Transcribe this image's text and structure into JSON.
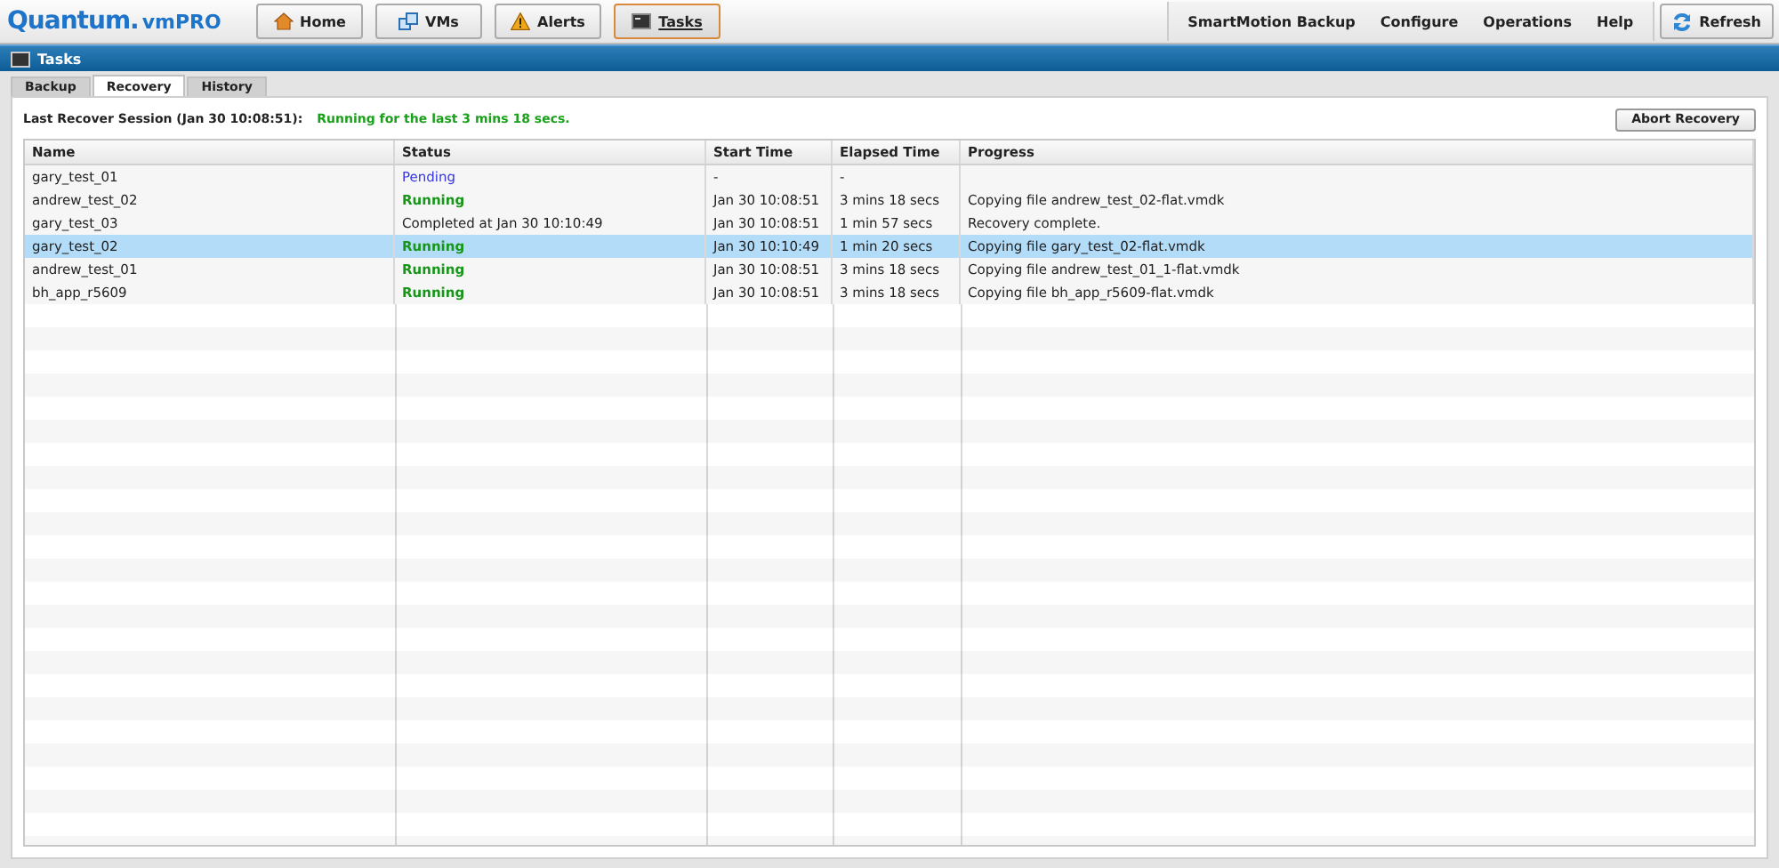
{
  "logo": {
    "brand": "Quantum.",
    "product": "vmPRO"
  },
  "nav": [
    {
      "label": "Home",
      "kind": "home",
      "selected": false
    },
    {
      "label": "VMs",
      "kind": "vms",
      "selected": false
    },
    {
      "label": "Alerts",
      "kind": "alerts",
      "selected": false
    },
    {
      "label": "Tasks",
      "kind": "tasks",
      "selected": true
    }
  ],
  "menu": [
    "SmartMotion Backup",
    "Configure",
    "Operations",
    "Help"
  ],
  "refresh_button": "Refresh",
  "panel_title": "Tasks",
  "tabs": [
    {
      "label": "Backup",
      "selected": false
    },
    {
      "label": "Recovery",
      "selected": true
    },
    {
      "label": "History",
      "selected": false
    }
  ],
  "session": {
    "label": "Last Recover Session (Jan 30 10:08:51):",
    "status": "Running for the last 3 mins 18 secs."
  },
  "abort_button": "Abort Recovery",
  "table": {
    "columns": [
      "Name",
      "Status",
      "Start Time",
      "Elapsed Time",
      "Progress"
    ],
    "rows": [
      {
        "name": "gary_test_01",
        "status": "Pending",
        "kind": "pending",
        "start": "-",
        "elapsed": "-",
        "progress": "",
        "selected": false
      },
      {
        "name": "andrew_test_02",
        "status": "Running",
        "kind": "running",
        "start": "Jan 30 10:08:51",
        "elapsed": "3 mins 18 secs",
        "progress": "Copying file andrew_test_02-flat.vmdk",
        "selected": false
      },
      {
        "name": "gary_test_03",
        "status": "Completed at Jan 30 10:10:49",
        "kind": "completed",
        "start": "Jan 30 10:08:51",
        "elapsed": "1 min 57 secs",
        "progress": "Recovery complete.",
        "selected": false
      },
      {
        "name": "gary_test_02",
        "status": "Running",
        "kind": "running",
        "start": "Jan 30 10:10:49",
        "elapsed": "1 min 20 secs",
        "progress": "Copying file gary_test_02-flat.vmdk",
        "selected": true
      },
      {
        "name": "andrew_test_01",
        "status": "Running",
        "kind": "running",
        "start": "Jan 30 10:08:51",
        "elapsed": "3 mins 18 secs",
        "progress": "Copying file andrew_test_01_1-flat.vmdk",
        "selected": false
      },
      {
        "name": "bh_app_r5609",
        "status": "Running",
        "kind": "running",
        "start": "Jan 30 10:08:51",
        "elapsed": "3 mins 18 secs",
        "progress": "Copying file bh_app_r5609-flat.vmdk",
        "selected": false
      }
    ]
  }
}
